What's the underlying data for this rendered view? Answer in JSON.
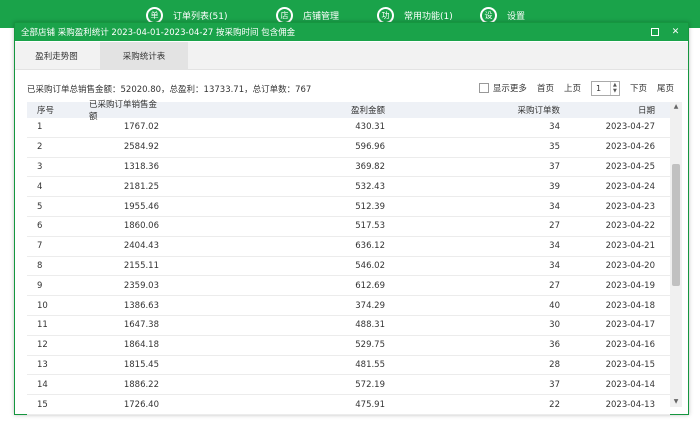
{
  "nav": [
    {
      "icon_char": "单",
      "label": "订单列表(51)"
    },
    {
      "icon_char": "店",
      "label": "店铺管理"
    },
    {
      "icon_char": "功",
      "label": "常用功能(1)"
    },
    {
      "icon_char": "设",
      "label": "设置"
    }
  ],
  "dialog": {
    "title": "全部店铺  采购盈利统计  2023-04-01-2023-04-27  按采购时间  包含佣金",
    "minimize": "□",
    "close": "✕"
  },
  "tabs": [
    "盈利走势图",
    "采购统计表"
  ],
  "summary": "已采购订单总销售金额：52020.80，总盈利：13733.71，总订单数：767",
  "pager": {
    "show_more": "显示更多",
    "first": "首页",
    "prev": "上页",
    "page": "1",
    "next": "下页",
    "last": "尾页"
  },
  "table": {
    "headers": [
      "序号",
      "已采购订单销售金额",
      "盈利金额",
      "采购订单数",
      "日期"
    ],
    "rows": [
      [
        "1",
        "1767.02",
        "430.31",
        "34",
        "2023-04-27"
      ],
      [
        "2",
        "2584.92",
        "596.96",
        "35",
        "2023-04-26"
      ],
      [
        "3",
        "1318.36",
        "369.82",
        "37",
        "2023-04-25"
      ],
      [
        "4",
        "2181.25",
        "532.43",
        "39",
        "2023-04-24"
      ],
      [
        "5",
        "1955.46",
        "512.39",
        "34",
        "2023-04-23"
      ],
      [
        "6",
        "1860.06",
        "517.53",
        "27",
        "2023-04-22"
      ],
      [
        "7",
        "2404.43",
        "636.12",
        "34",
        "2023-04-21"
      ],
      [
        "8",
        "2155.11",
        "546.02",
        "34",
        "2023-04-20"
      ],
      [
        "9",
        "2359.03",
        "612.69",
        "27",
        "2023-04-19"
      ],
      [
        "10",
        "1386.63",
        "374.29",
        "40",
        "2023-04-18"
      ],
      [
        "11",
        "1647.38",
        "488.31",
        "30",
        "2023-04-17"
      ],
      [
        "12",
        "1864.18",
        "529.75",
        "36",
        "2023-04-16"
      ],
      [
        "13",
        "1815.45",
        "481.55",
        "28",
        "2023-04-15"
      ],
      [
        "14",
        "1886.22",
        "572.19",
        "37",
        "2023-04-14"
      ],
      [
        "15",
        "1726.40",
        "475.91",
        "22",
        "2023-04-13"
      ]
    ]
  },
  "colors": {
    "accent": "#1aa34a",
    "header_bg": "#eef1f6"
  }
}
